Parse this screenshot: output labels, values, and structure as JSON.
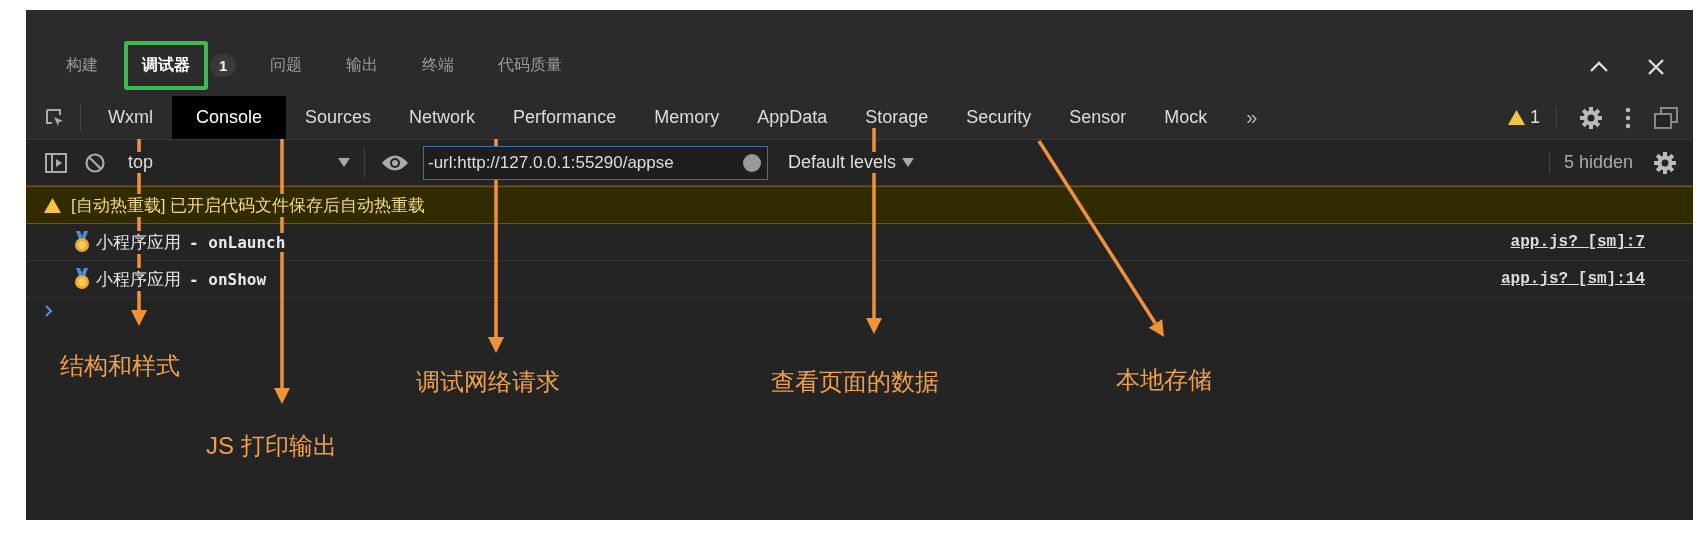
{
  "top_tabs": [
    {
      "label": "构建",
      "selected": false,
      "highlighted": false
    },
    {
      "label": "调试器",
      "selected": true,
      "highlighted": true,
      "badge": "1"
    },
    {
      "label": "问题",
      "selected": false,
      "highlighted": false
    },
    {
      "label": "输出",
      "selected": false,
      "highlighted": false
    },
    {
      "label": "终端",
      "selected": false,
      "highlighted": false
    },
    {
      "label": "代码质量",
      "selected": false,
      "highlighted": false
    }
  ],
  "panel_tabs": [
    {
      "label": "Wxml",
      "selected": false
    },
    {
      "label": "Console",
      "selected": true
    },
    {
      "label": "Sources",
      "selected": false
    },
    {
      "label": "Network",
      "selected": false
    },
    {
      "label": "Performance",
      "selected": false
    },
    {
      "label": "Memory",
      "selected": false
    },
    {
      "label": "AppData",
      "selected": false
    },
    {
      "label": "Storage",
      "selected": false
    },
    {
      "label": "Security",
      "selected": false
    },
    {
      "label": "Sensor",
      "selected": false
    },
    {
      "label": "Mock",
      "selected": false
    }
  ],
  "more_tabs": "»",
  "warning_count": "1",
  "filter_bar": {
    "context": "top",
    "filter_value": "-url:http://127.0.0.1:55290/appse",
    "levels": "Default levels",
    "hidden_count": "5 hidden"
  },
  "console": [
    {
      "kind": "warning",
      "text": "[自动热重载] 已开启代码文件保存后自动热重载"
    },
    {
      "kind": "log",
      "app": "小程序应用",
      "text": "- onLaunch",
      "source": "app.js? [sm]:7"
    },
    {
      "kind": "log",
      "app": "小程序应用",
      "text": "- onShow",
      "source": "app.js? [sm]:14"
    }
  ],
  "annotations": [
    {
      "label": "结构和样式"
    },
    {
      "label": "JS 打印输出"
    },
    {
      "label": "调试网络请求"
    },
    {
      "label": "查看页面的数据"
    },
    {
      "label": "本地存储"
    }
  ]
}
